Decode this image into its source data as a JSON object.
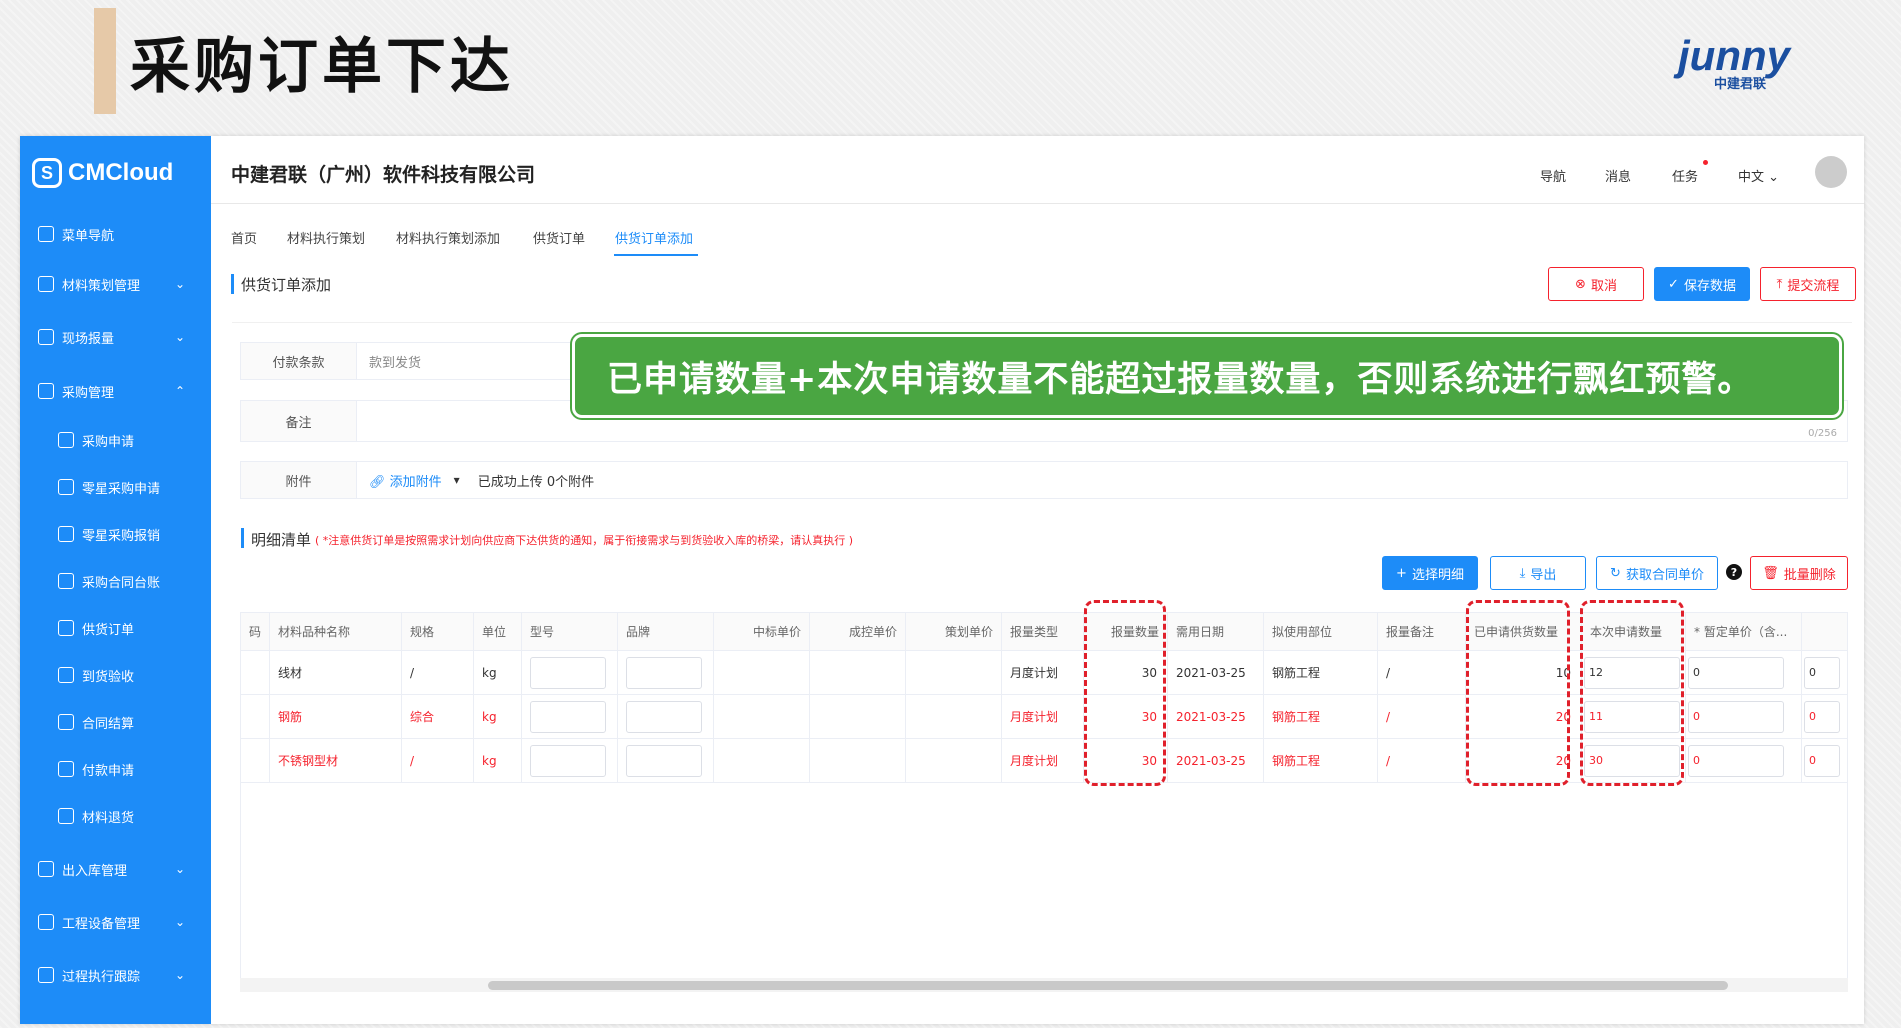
{
  "slide": {
    "title": "采购订单下达",
    "brand_text": "junny",
    "brand_sub": "中建君联"
  },
  "sidebar": {
    "logo": "CMCloud",
    "items": [
      {
        "label": "菜单导航",
        "icon": "grid-icon",
        "chev": ""
      },
      {
        "label": "材料策划管理",
        "icon": "materials-icon",
        "chev": "⌄"
      },
      {
        "label": "现场报量",
        "icon": "report-icon",
        "chev": "⌄"
      },
      {
        "label": "采购管理",
        "icon": "purchase-icon",
        "chev": "⌃"
      },
      {
        "label": "采购申请",
        "icon": "doc-icon",
        "chev": ""
      },
      {
        "label": "零星采购申请",
        "icon": "doc-icon",
        "chev": ""
      },
      {
        "label": "零星采购报销",
        "icon": "doc-icon",
        "chev": ""
      },
      {
        "label": "采购合同台账",
        "icon": "doc-icon",
        "chev": ""
      },
      {
        "label": "供货订单",
        "icon": "doc-icon",
        "chev": ""
      },
      {
        "label": "到货验收",
        "icon": "check-icon",
        "chev": ""
      },
      {
        "label": "合同结算",
        "icon": "doc-icon",
        "chev": ""
      },
      {
        "label": "付款申请",
        "icon": "doc-icon",
        "chev": ""
      },
      {
        "label": "材料退货",
        "icon": "return-icon",
        "chev": ""
      },
      {
        "label": "出入库管理",
        "icon": "warehouse-icon",
        "chev": "⌄"
      },
      {
        "label": "工程设备管理",
        "icon": "equipment-icon",
        "chev": "⌄"
      },
      {
        "label": "过程执行跟踪",
        "icon": "track-icon",
        "chev": "⌄"
      }
    ]
  },
  "header": {
    "company": "中建君联（广州）软件科技有限公司",
    "nav": [
      "导航",
      "消息",
      "任务",
      "中文"
    ]
  },
  "tabs": [
    "首页",
    "材料执行策划",
    "材料执行策划添加",
    "供货订单",
    "供货订单添加"
  ],
  "page": {
    "section_title": "供货订单添加",
    "buttons": {
      "cancel": "取消",
      "save": "保存数据",
      "submit": "提交流程"
    }
  },
  "form": {
    "payment_label": "付款条款",
    "payment_value": "款到发货",
    "remark_label": "备注",
    "remark_count": "0/256",
    "attach_label": "附件",
    "attach_link": "添加附件",
    "attach_status": "已成功上传 0个附件"
  },
  "callout": "已申请数量+本次申请数量不能超过报量数量，否则系统进行飘红预警。",
  "detail": {
    "title": "明细清单",
    "note": "( *注意供货订单是按照需求计划向供应商下达供货的通知，属于衔接需求与到货验收入库的桥梁，请认真执行 )",
    "buttons": {
      "select": "选择明细",
      "export": "导出",
      "fetch_price": "获取合同单价",
      "batch_delete": "批量删除"
    }
  },
  "table": {
    "headers": [
      "码",
      "材料品种名称",
      "规格",
      "单位",
      "型号",
      "品牌",
      "中标单价",
      "成控单价",
      "策划单价",
      "报量类型",
      "报量数量",
      "需用日期",
      "拟使用部位",
      "报量备注",
      "已申请供货数量",
      "本次申请数量",
      "* 暂定单价（含...",
      ""
    ],
    "rows": [
      {
        "name": "线材",
        "spec": "/",
        "unit": "kg",
        "type": "月度计划",
        "qty": "30",
        "date": "2021-03-25",
        "part": "钢筋工程",
        "remark": "/",
        "applied": "10",
        "current": "12",
        "price": "0",
        "extra": "0",
        "warn": false
      },
      {
        "name": "钢筋",
        "spec": "综合",
        "unit": "kg",
        "type": "月度计划",
        "qty": "30",
        "date": "2021-03-25",
        "part": "钢筋工程",
        "remark": "/",
        "applied": "20",
        "current": "11",
        "price": "0",
        "extra": "0",
        "warn": true
      },
      {
        "name": "不锈钢型材",
        "spec": "/",
        "unit": "kg",
        "type": "月度计划",
        "qty": "30",
        "date": "2021-03-25",
        "part": "钢筋工程",
        "remark": "/",
        "applied": "20",
        "current": "30",
        "price": "0",
        "extra": "0",
        "warn": true
      }
    ]
  },
  "colors": {
    "primary": "#1d8cf8",
    "danger": "#f5222d",
    "callout": "#4aa642"
  }
}
